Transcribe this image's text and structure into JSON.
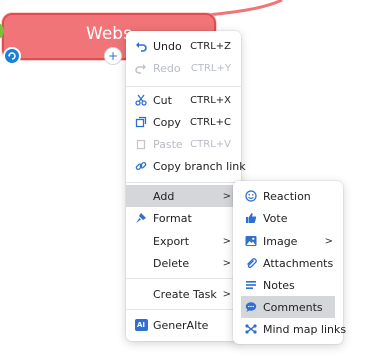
{
  "node": {
    "title": "Webs"
  },
  "main_menu": {
    "undo": {
      "label": "Undo",
      "shortcut": "CTRL+Z",
      "icon": "undo-icon"
    },
    "redo": {
      "label": "Redo",
      "shortcut": "CTRL+Y",
      "icon": "redo-icon"
    },
    "cut": {
      "label": "Cut",
      "shortcut": "CTRL+X",
      "icon": "scissors-icon"
    },
    "copy": {
      "label": "Copy",
      "shortcut": "CTRL+C",
      "icon": "copy-icon"
    },
    "paste": {
      "label": "Paste",
      "shortcut": "CTRL+V",
      "icon": "paste-icon"
    },
    "copy_branch_link": {
      "label": "Copy branch link",
      "icon": "link-icon"
    },
    "add": {
      "label": "Add",
      "arrow": ">"
    },
    "format": {
      "label": "Format",
      "icon": "paintbrush-icon"
    },
    "export": {
      "label": "Export",
      "arrow": ">"
    },
    "delete": {
      "label": "Delete",
      "arrow": ">"
    },
    "create_task": {
      "label": "Create Task",
      "arrow": ">"
    },
    "generaite": {
      "label": "GenerAIte",
      "badge": "AI"
    }
  },
  "add_submenu": {
    "reaction": {
      "label": "Reaction",
      "icon": "smiley-icon"
    },
    "vote": {
      "label": "Vote",
      "icon": "thumbs-up-icon"
    },
    "image": {
      "label": "Image",
      "icon": "image-icon",
      "arrow": ">"
    },
    "attachments": {
      "label": "Attachments",
      "icon": "paperclip-icon"
    },
    "notes": {
      "label": "Notes",
      "icon": "notes-icon"
    },
    "comments": {
      "label": "Comments",
      "icon": "comment-icon"
    },
    "mind_map_links": {
      "label": "Mind map links",
      "icon": "mindmap-link-icon"
    }
  },
  "colors": {
    "accent": "#1b7fd6",
    "node_fill": "#f07478",
    "node_border": "#e14c52",
    "highlight": "#d4d6da"
  }
}
